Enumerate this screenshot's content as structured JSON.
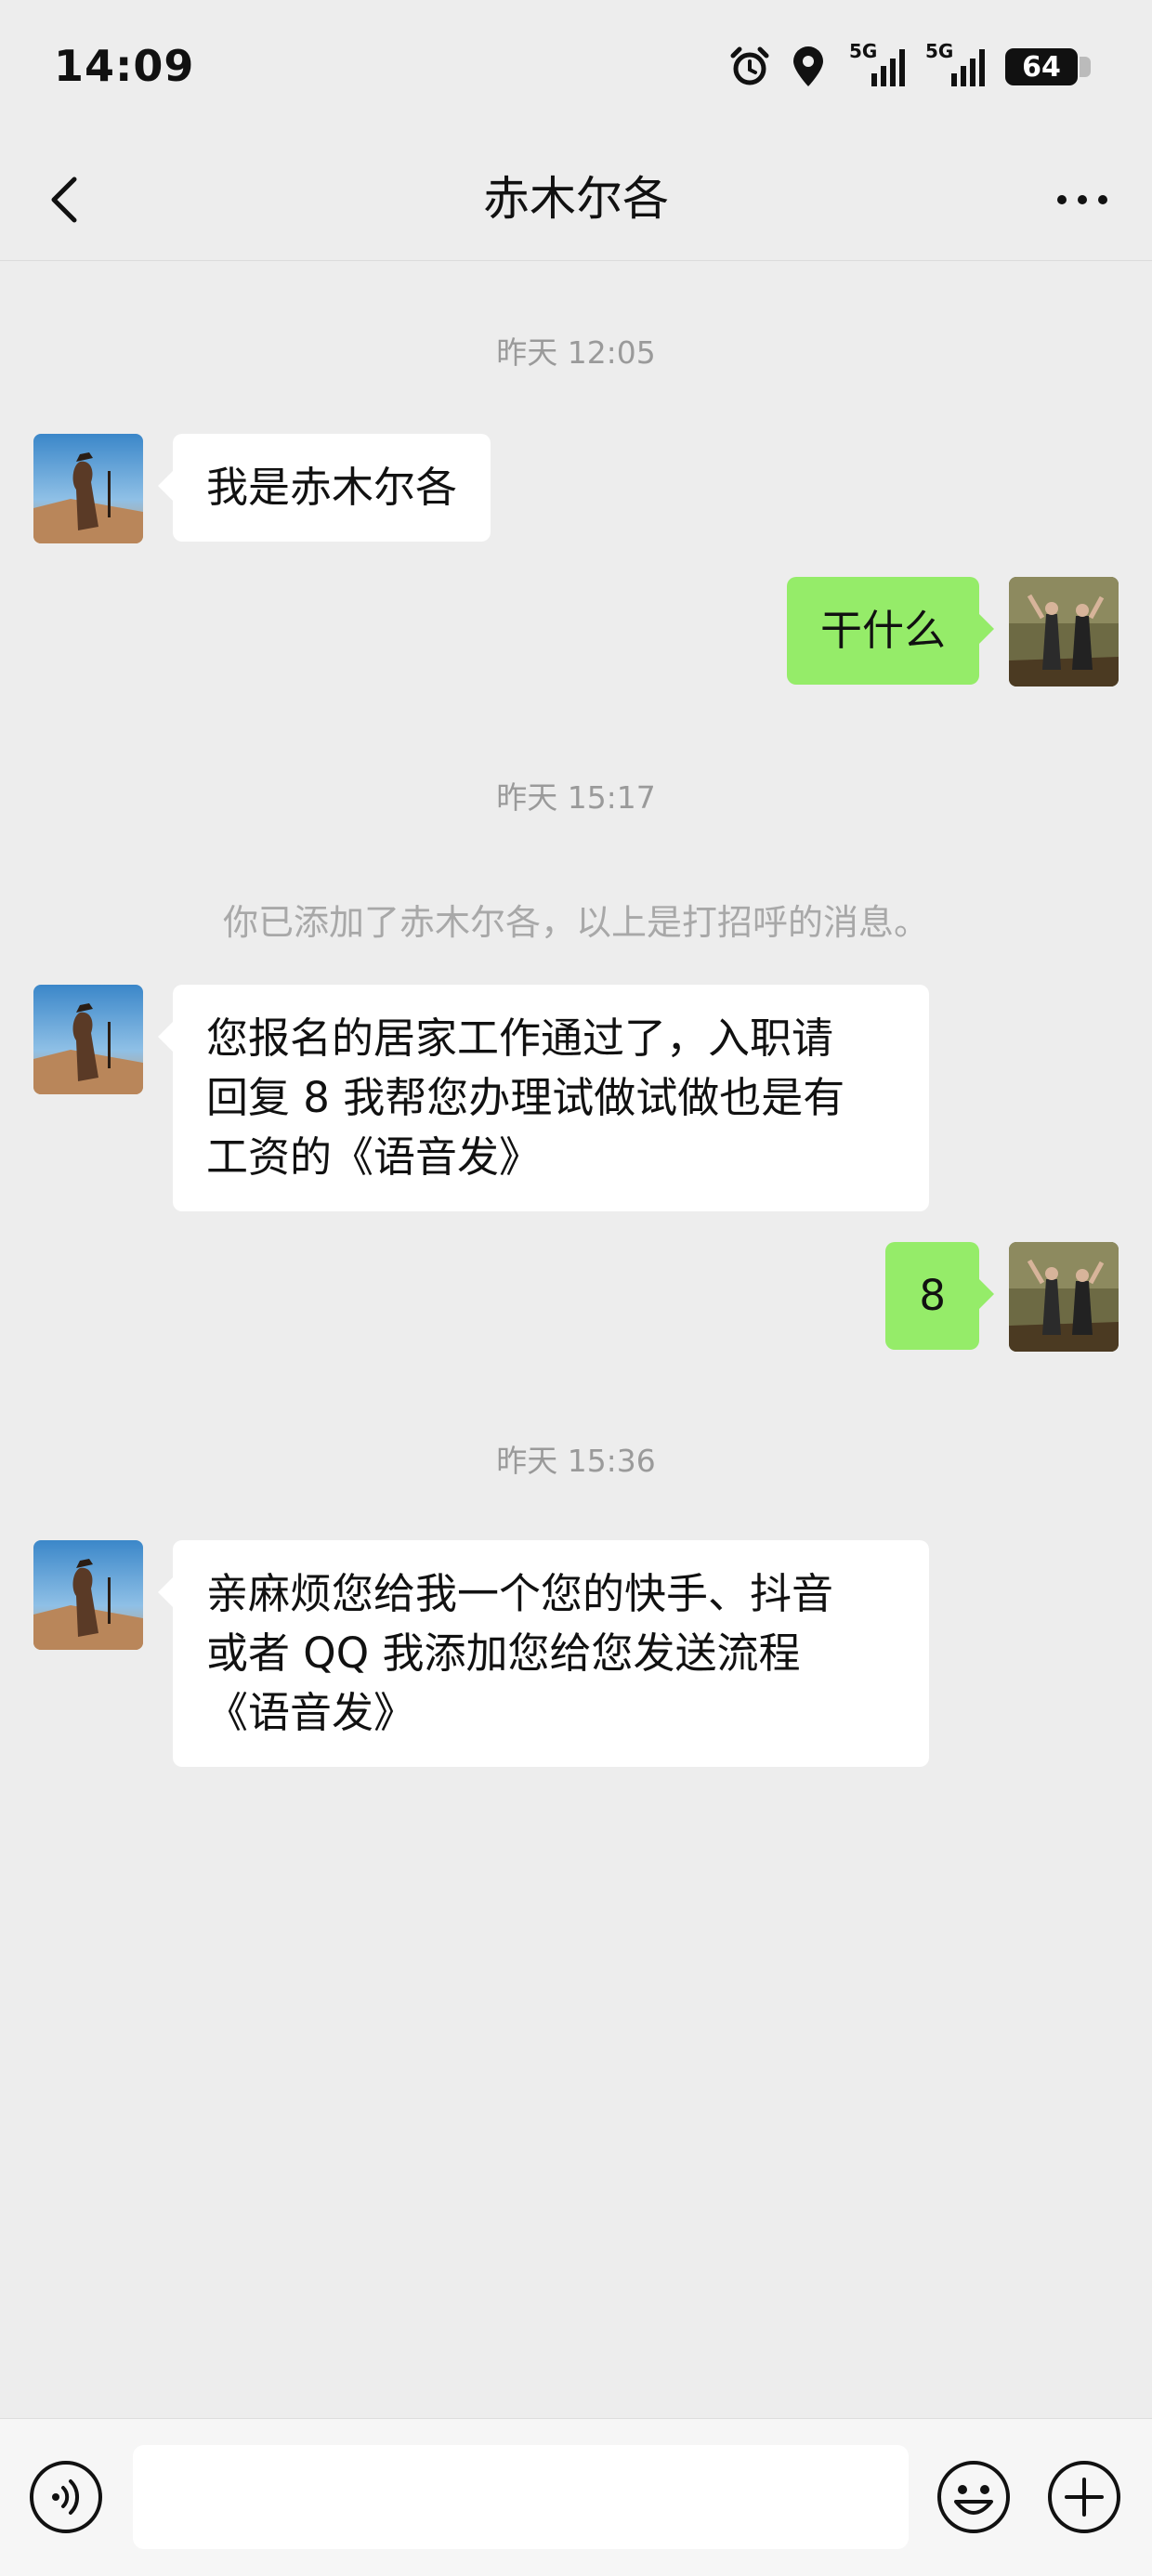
{
  "status_bar": {
    "time": "14:09",
    "signal_1": "5G",
    "signal_2": "5G",
    "battery": "64"
  },
  "header": {
    "title": "赤木尔各"
  },
  "messages": [
    {
      "type": "timestamp",
      "text": "昨天 12:05"
    },
    {
      "type": "incoming",
      "text": "我是赤木尔各"
    },
    {
      "type": "outgoing",
      "text": "干什么"
    },
    {
      "type": "timestamp",
      "text": "昨天 15:17"
    },
    {
      "type": "system",
      "text": "你已添加了赤木尔各，以上是打招呼的消息。"
    },
    {
      "type": "incoming",
      "lines": [
        "您报名的居家工作通过了，入职请",
        "回复 8 我帮您办理试做试做也是有",
        "工资的《语音发》"
      ]
    },
    {
      "type": "outgoing",
      "text": "8"
    },
    {
      "type": "timestamp",
      "text": "昨天 15:36"
    },
    {
      "type": "incoming",
      "lines": [
        "亲麻烦您给我一个您的快手、抖音",
        "或者 QQ 我添加您给您发送流程",
        "《语音发》"
      ]
    }
  ],
  "input_bar": {
    "value": "",
    "placeholder": ""
  },
  "colors": {
    "background": "#ededed",
    "outgoing_bubble": "#95ec69",
    "incoming_bubble": "#ffffff",
    "timestamp": "#9a9a9a"
  },
  "icons": {
    "back": "chevron-left-icon",
    "more": "more-dots-icon",
    "voice": "voice-icon",
    "emoji": "emoji-icon",
    "plus": "plus-circle-icon",
    "alarm": "alarm-icon",
    "location": "location-icon"
  }
}
